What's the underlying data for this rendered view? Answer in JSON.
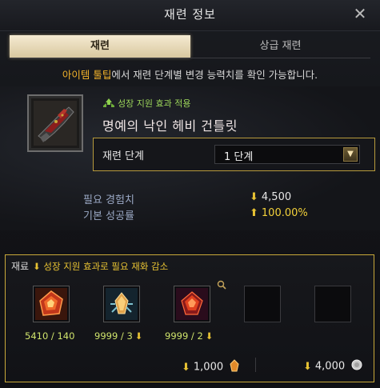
{
  "window": {
    "title": "재련 정보",
    "close_icon": "close-icon"
  },
  "tabs": [
    {
      "label": "재련",
      "active": true
    },
    {
      "label": "상급 재련",
      "active": false
    }
  ],
  "notice": {
    "highlight": "아이템 툴팁",
    "text": "에서 재련 단계별 변경 능력치를 확인 가능합니다."
  },
  "item": {
    "growth_text": "성장 지원 효과 적용",
    "name": "명예의 낙인 헤비 건틀릿",
    "stage_label": "재련 단계",
    "stage_value": "1 단계"
  },
  "requirements": {
    "exp_label": "필요 경험치",
    "exp_value": "4,500",
    "rate_label": "기본 성공률",
    "rate_value": "100.00%"
  },
  "materials": {
    "title": "재료",
    "subtitle": "성장 지원 효과로 필요 재화 감소",
    "slots": [
      {
        "count": "5410 / 140",
        "reduced": false
      },
      {
        "count": "9999 / 3",
        "reduced": true
      },
      {
        "count": "9999 / 2",
        "reduced": true
      }
    ],
    "cost_1": "1,000",
    "cost_2": "4,000"
  },
  "colors": {
    "accent": "#c9a93a",
    "highlight": "#f3b32a",
    "growth": "#9bd45a",
    "count": "#cfe36b"
  }
}
